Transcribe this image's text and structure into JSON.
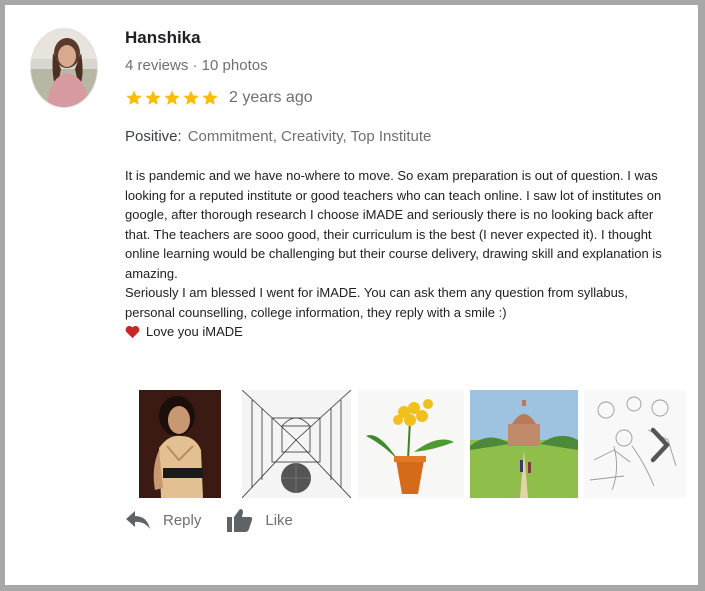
{
  "reviewer": {
    "name": "Hanshika",
    "meta": "4 reviews · 10 photos"
  },
  "rating": {
    "stars": 5,
    "time": "2 years ago",
    "star_color": "#fbbc04"
  },
  "highlights": {
    "label": "Positive:",
    "values": "Commitment, Creativity, Top Institute"
  },
  "review": {
    "paragraph1": "It is pandemic and we have no-where to move. So exam preparation is out of question. I was looking for a reputed institute or good teachers who can teach online. I saw lot of institutes on google, after thorough research I choose iMADE and seriously there is no looking back after that. The teachers are sooo good, their curriculum is the best (I never expected it). I thought online learning would be challenging but their course delivery, drawing skill and explanation is amazing.",
    "paragraph2": "Seriously I am blessed I went for iMADE. You can ask them any question from syllabus, personal counselling, college information, they reply with a smile :)",
    "closing": "Love you iMADE"
  },
  "photos": [
    {
      "name": "photo-woman-portrait"
    },
    {
      "name": "photo-perspective-sketch"
    },
    {
      "name": "photo-flower-painting"
    },
    {
      "name": "photo-monument-painting"
    },
    {
      "name": "photo-figure-sketch"
    }
  ],
  "actions": {
    "reply_label": "Reply",
    "like_label": "Like"
  },
  "colors": {
    "icon_gray": "#5f6368",
    "heart": "#d93025"
  }
}
